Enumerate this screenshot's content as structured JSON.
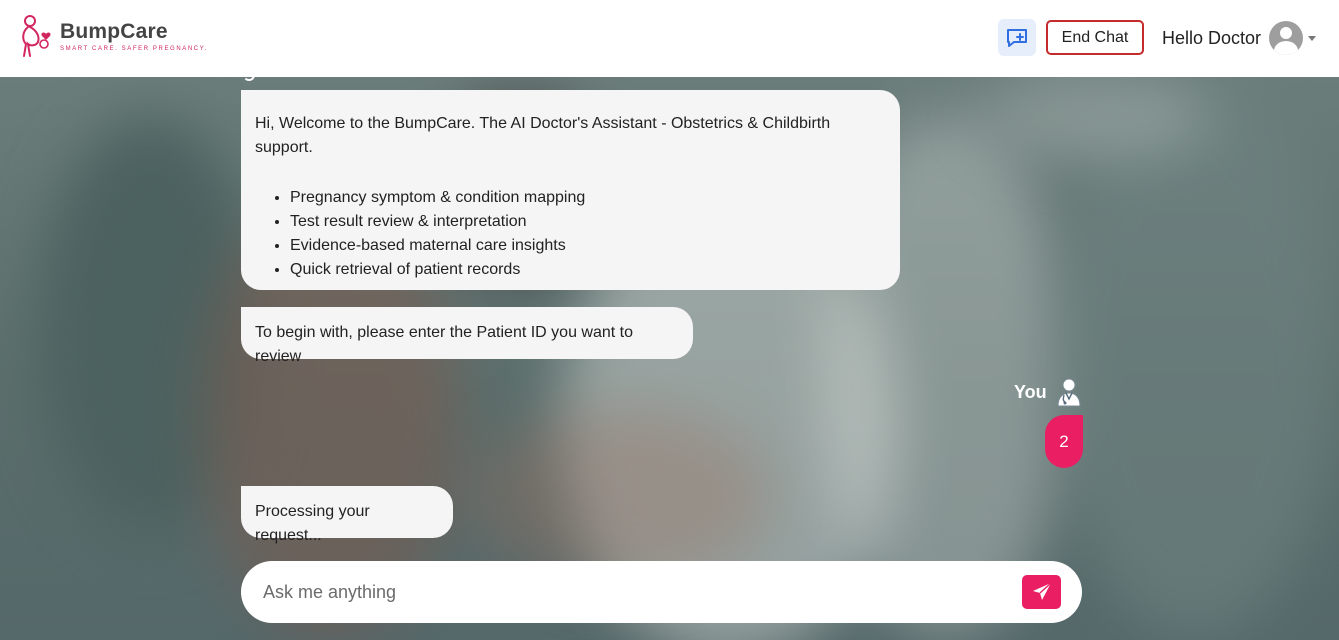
{
  "header": {
    "brand_name": "BumpCare",
    "brand_tagline": "SMART CARE. SAFER PREGNANCY.",
    "new_chat_icon": "chat-plus-icon",
    "end_chat_label": "End Chat",
    "greeting": "Hello Doctor",
    "avatar_icon": "user-avatar-icon",
    "menu_icon": "caret-down-icon"
  },
  "chat": {
    "welcome_text": "Hi, Welcome to the BumpCare. The AI Doctor's Assistant - Obstetrics & Childbirth support.",
    "features": [
      "Pregnancy symptom & condition mapping",
      "Test result review & interpretation",
      "Evidence-based maternal care insights",
      "Quick retrieval of patient records"
    ],
    "prompt_text": "To begin with, please enter the Patient ID you want to review",
    "user_label": "You",
    "user_icon": "doctor-icon",
    "user_message": "2",
    "processing_text": "Processing your request..."
  },
  "composer": {
    "placeholder": "Ask me anything",
    "value": "",
    "send_icon": "paper-plane-icon"
  },
  "colors": {
    "accent": "#e91e63",
    "end_chat_border": "#c42b2b",
    "new_chat_bg": "#e6eefc",
    "bot_bubble": "#f5f5f5"
  }
}
